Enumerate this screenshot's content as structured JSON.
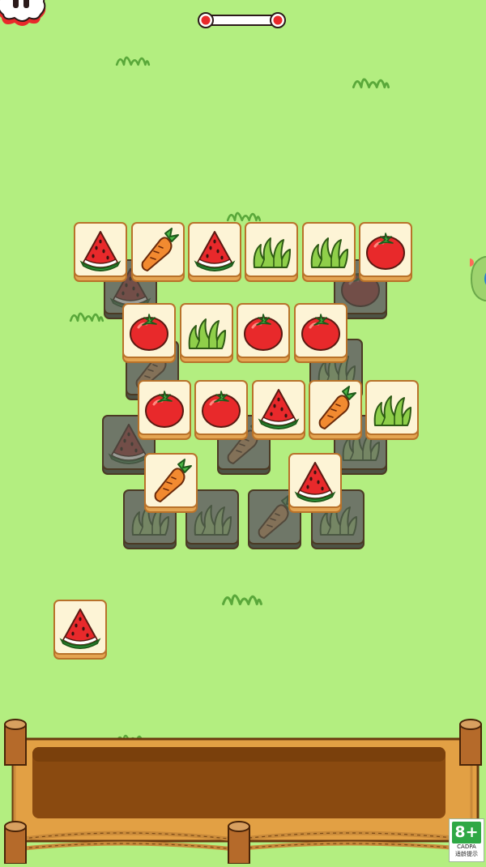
{
  "game": {
    "tile_types": [
      "watermelon",
      "carrot",
      "lettuce",
      "tomato"
    ],
    "board": {
      "top_tiles": [
        {
          "item": "watermelon"
        },
        {
          "item": "carrot"
        },
        {
          "item": "watermelon"
        },
        {
          "item": "lettuce"
        },
        {
          "item": "lettuce"
        },
        {
          "item": "tomato"
        },
        {
          "item": "tomato"
        },
        {
          "item": "lettuce"
        },
        {
          "item": "tomato"
        },
        {
          "item": "tomato"
        },
        {
          "item": "tomato"
        },
        {
          "item": "tomato"
        },
        {
          "item": "watermelon"
        },
        {
          "item": "carrot"
        },
        {
          "item": "lettuce"
        },
        {
          "item": "carrot"
        },
        {
          "item": "watermelon"
        }
      ],
      "covered_tiles": [
        {
          "item": "watermelon"
        },
        {
          "item": "carrot"
        },
        {
          "item": "lettuce"
        },
        {
          "item": "carrot"
        },
        {
          "item": "lettuce"
        },
        {
          "item": "carrot"
        },
        {
          "item": "lettuce"
        }
      ]
    },
    "tray_tiles": [],
    "floating_tile": {
      "item": "watermelon"
    },
    "progress_bar": {
      "start_marker": "red-dot",
      "end_marker": "red-dot"
    }
  },
  "age_rating": {
    "rating": "8+",
    "org": "CADPA",
    "notice": "适龄提示"
  },
  "colors": {
    "background": "#b3ee80",
    "tile_face": "#fdf4d6",
    "tile_border": "#b8722a",
    "tray_wood": "#e2a044",
    "tray_slot": "#8a4a10",
    "accent_red": "#e8292b"
  },
  "icons": [
    "pause-icon",
    "progress-bar-icon",
    "side-menu-icon",
    "grass-icon",
    "watermelon-icon",
    "carrot-icon",
    "lettuce-icon",
    "tomato-icon",
    "fence-post-icon",
    "rope-icon"
  ]
}
